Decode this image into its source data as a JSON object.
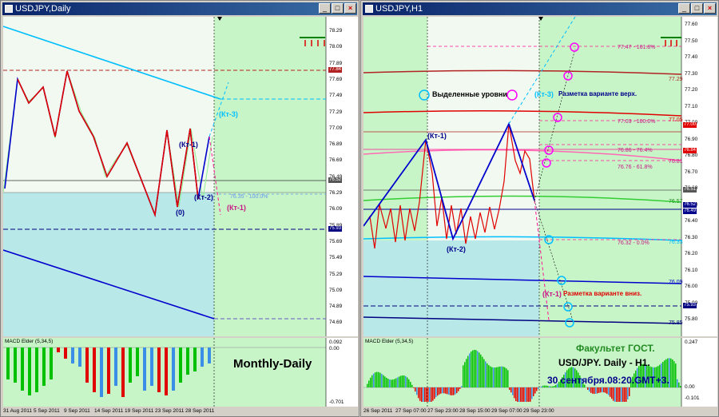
{
  "left": {
    "title": "USDJPY,Daily",
    "macd_label": "MACD Elder (5,34,5)",
    "macd_scale": {
      "top": "0.092",
      "zero": "0.00",
      "bottom": "-0.701"
    },
    "overlay_text": "Monthly-Daily",
    "labels": {
      "kt1": "(Кт-1)",
      "kt2": "(Кт-2)",
      "kt3": "(Кт-3)",
      "zero": "(0)",
      "kt1b": "(Кт-1)",
      "fib": "76.35 - 100.0%"
    },
    "price_axis": [
      "78.29",
      "78.09",
      "77.89",
      "77.69",
      "77.49",
      "77.29",
      "77.09",
      "76.89",
      "76.69",
      "76.49",
      "76.29",
      "76.09",
      "75.89",
      "75.69",
      "75.49",
      "75.29",
      "75.09",
      "74.89",
      "74.69"
    ],
    "price_tags": {
      "red": "77.84",
      "grey": "76.52",
      "navy": "75.93"
    },
    "time_axis": [
      "31 Aug 2011",
      "5 Sep 2011",
      "9 Sep 2011",
      "14 Sep 2011",
      "19 Sep 2011",
      "23 Sep 2011",
      "28 Sep 2011"
    ]
  },
  "right": {
    "title": "USDJPY,H1",
    "macd_label": "MACD Elder (5,34,5)",
    "macd_scale": {
      "top": "0.247",
      "zero": "0.00",
      "bottom": "-0.101"
    },
    "legend_levels": "Выделенные уровни",
    "legend_upper": "Разметка варианте верх.",
    "legend_lower": "Разметка варианте вниз.",
    "labels": {
      "kt1": "(Кт-1)",
      "kt2": "(Кт-2)",
      "kt3": "(Кт-3)",
      "kt1b": "(Кт-1)"
    },
    "fib_labels": [
      "77.47 - 161.8%",
      "77.03 - 100.0%",
      "76.86 - 76.4%",
      "76.76 - 61.8%",
      "76.32 - 0.0%"
    ],
    "level_labels": [
      "77.29",
      "77.05",
      "76.81",
      "76.57",
      "76.33",
      "76.09",
      "75.85"
    ],
    "price_axis": [
      "77.60",
      "77.50",
      "77.40",
      "77.30",
      "77.20",
      "77.10",
      "77.00",
      "76.90",
      "76.80",
      "76.70",
      "76.60",
      "76.50",
      "76.40",
      "76.30",
      "76.20",
      "76.10",
      "76.00",
      "75.90",
      "75.80"
    ],
    "price_tags": {
      "red1": "77.00",
      "red2": "76.84",
      "grey": "76.51",
      "blue1": "76.52",
      "blue2": "76.49",
      "navy": "75.93"
    },
    "time_axis": [
      "26 Sep 2011",
      "27 Sep 07:00",
      "27 Sep 23:00",
      "28 Sep 15:00",
      "29 Sep 07:00",
      "29 Sep 23:00"
    ],
    "footer": {
      "line1": "Факультет ГОСТ.",
      "line2": "USD/JPY. Daily - H1.",
      "line3": "30 сентября.08:20.GMT+3."
    }
  },
  "colors": {
    "chart_bg": "#c8f5c8",
    "title_bar": "#0a246a",
    "close_red": "#c00000",
    "accent_blue": "#00008b"
  }
}
